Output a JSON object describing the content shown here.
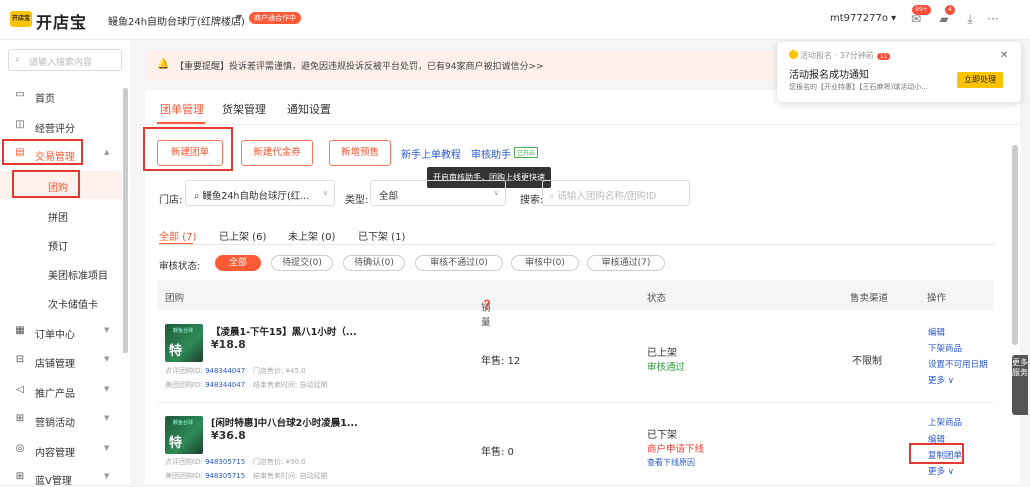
{
  "topbar": {
    "logo_mark": "开店宝",
    "logo_text": "开店宝",
    "store_name": "鳗鱼24h自助台球厅(红牌楼店)",
    "store_badge": "商户通合作中",
    "account": "mt977277o",
    "badges": {
      "messages": "99+",
      "alerts": "4"
    }
  },
  "sidebar": {
    "search_placeholder": "请输入搜索内容",
    "items": [
      {
        "label": "首页",
        "icon": "monitor-icon"
      },
      {
        "label": "经营评分",
        "icon": "cup-icon"
      },
      {
        "label": "交易管理",
        "icon": "card-icon",
        "expanded": true
      },
      {
        "label": "团购",
        "sub": true,
        "active": true
      },
      {
        "label": "拼团",
        "sub": true
      },
      {
        "label": "预订",
        "sub": true
      },
      {
        "label": "美团标准项目",
        "sub": true
      },
      {
        "label": "次卡储值卡",
        "sub": true
      },
      {
        "label": "订单中心",
        "icon": "order-icon"
      },
      {
        "label": "店铺管理",
        "icon": "store-icon"
      },
      {
        "label": "推广产品",
        "icon": "megaphone-icon"
      },
      {
        "label": "营销活动",
        "icon": "gift-icon"
      },
      {
        "label": "内容管理",
        "icon": "content-icon"
      },
      {
        "label": "蓝V管理",
        "icon": "grid-icon"
      }
    ]
  },
  "notice": {
    "text": "【重要提醒】投诉差评需谨慎，避免因违规投诉反被平台处罚，已有94家商户被扣诚信分>>"
  },
  "toast": {
    "header": "活动报名 · 37分钟前",
    "count": "11",
    "title": "活动报名成功通知",
    "desc": "您报名的【开业特惠】【王石麻将)球活动小...",
    "action": "立即处理"
  },
  "tabs": [
    "团单管理",
    "货架管理",
    "通知设置"
  ],
  "actions": {
    "new_group": "新建团单",
    "new_voucher": "新建代金券",
    "new_presale": "新增预售",
    "tutorial": "新手上单教程",
    "audit_helper": "审核助手",
    "audit_helper_tag": "已开启",
    "tooltip": "开启审核助手，团购上线更快速"
  },
  "filters": {
    "store_label": "门店:",
    "store_value": "鳗鱼24h自助台球厅(红...",
    "type_label": "类型:",
    "type_value": "全部",
    "search_label": "搜索:",
    "search_placeholder": "请输入团购名称/团购ID"
  },
  "status_tabs": [
    "全部 (7)",
    "已上架 (6)",
    "未上架 (0)",
    "已下架 (1)"
  ],
  "audit": {
    "label": "审核状态:",
    "pills": [
      "全部",
      "待提交(0)",
      "待确认(0)",
      "审核不通过(0)",
      "审核中(0)",
      "审核通过(7)"
    ]
  },
  "table": {
    "headers": [
      "团购",
      "销量",
      "状态",
      "售卖渠道",
      "操作"
    ],
    "rows": [
      {
        "thumb_top": "鳗鱼台球",
        "thumb_text": "特惠",
        "name": "【凌晨1-下午15】黑八1小时（...",
        "price": "¥18.8",
        "dp_label": "点评团购ID:",
        "dp_id": "948344047",
        "mt_label": "美团团购ID:",
        "mt_id": "948344047",
        "store_price": "门店售价: ¥45.0",
        "end_time": "结束售卖时间: 自动延期",
        "sales": "年售: 12",
        "status": "已上架",
        "audit_status": "审核通过",
        "status_link": "",
        "channel": "不限制",
        "ops": [
          "编辑",
          "下架商品",
          "设置不可用日期",
          "更多 ∨"
        ]
      },
      {
        "thumb_top": "鳗鱼台球",
        "thumb_text": "特惠",
        "name": "[闲时特惠]中八台球2小时凌晨1...",
        "price": "¥36.8",
        "dp_label": "点评团购ID:",
        "dp_id": "948305715",
        "mt_label": "美团团购ID:",
        "mt_id": "948305715",
        "store_price": "门店售价: ¥90.0",
        "end_time": "结束售卖时间: 自动延期",
        "sales": "年售: 0",
        "status": "已下架",
        "audit_status": "商户申请下线",
        "status_link": "查看下线原因",
        "channel": "",
        "ops": [
          "上架商品",
          "编辑",
          "复制团单",
          "更多 ∨"
        ]
      }
    ]
  },
  "float_service": "更多服务",
  "colors": {
    "accent": "#ff5a36",
    "link": "#2b58d6",
    "success": "#2e9e3f",
    "highlight_box": "#e53935"
  }
}
